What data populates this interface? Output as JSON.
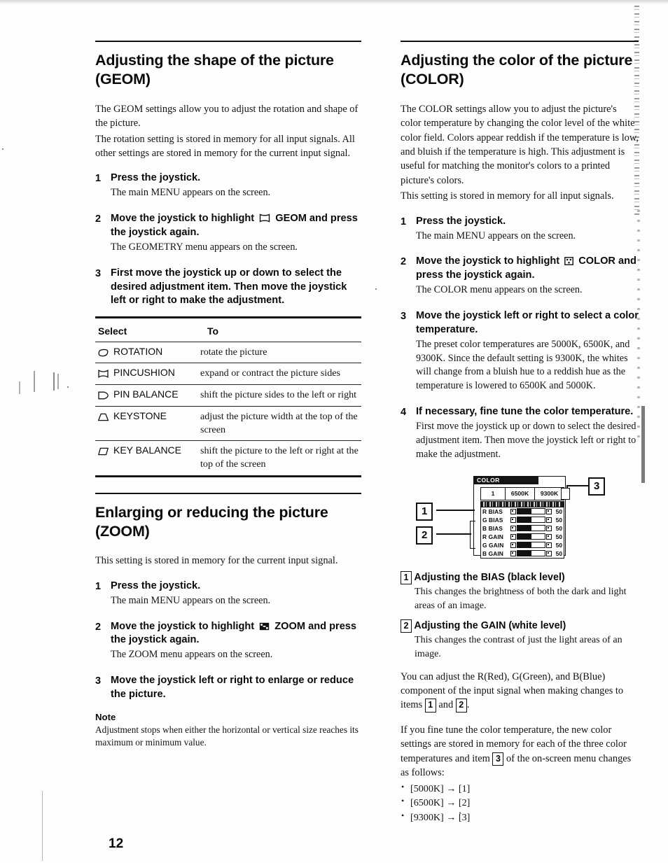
{
  "page": {
    "number": "12"
  },
  "left_column": {
    "heading": "Adjusting the shape of the picture (GEOM)",
    "intro_1": "The GEOM settings allow you to adjust the rotation and shape of the picture.",
    "intro_2": "The rotation setting is stored in memory for all input signals. All other settings are stored in memory for the current input signal.",
    "steps": [
      {
        "num": "1",
        "title": "Press the joystick.",
        "desc": "The main MENU appears on the screen."
      },
      {
        "num": "2",
        "title_before": "Move the joystick to highlight",
        "icon": "geom-pincushion-icon",
        "title_after": "GEOM and press the joystick again.",
        "desc": "The GEOMETRY menu appears on the screen."
      },
      {
        "num": "3",
        "title": "First move the joystick up or down to select the desired adjustment item. Then move the joystick left or right to make the adjustment.",
        "desc": ""
      }
    ],
    "table": {
      "header_select": "Select",
      "header_to": "To",
      "rows": [
        {
          "icon": "rotation-icon",
          "select": "ROTATION",
          "to": "rotate the picture"
        },
        {
          "icon": "pincushion-icon",
          "select": "PINCUSHION",
          "to": "expand or contract the picture sides"
        },
        {
          "icon": "pin-balance-icon",
          "select": "PIN BALANCE",
          "to": "shift the picture sides to the left or right"
        },
        {
          "icon": "keystone-icon",
          "select": "KEYSTONE",
          "to": "adjust the picture width at the top of the screen"
        },
        {
          "icon": "key-balance-icon",
          "select": "KEY BALANCE",
          "to": "shift the picture to the left or right at the top of the screen"
        }
      ]
    },
    "zoom_heading": "Enlarging or reducing the picture (ZOOM)",
    "zoom_intro": "This setting is stored in memory for the current input signal.",
    "zoom_steps": [
      {
        "num": "1",
        "title": "Press the joystick.",
        "desc": "The main MENU appears on the screen."
      },
      {
        "num": "2",
        "title_before": "Move the joystick to highlight",
        "icon": "zoom-icon",
        "title_after": "ZOOM and press the joystick again.",
        "desc": "The ZOOM menu appears on the screen."
      },
      {
        "num": "3",
        "title": "Move the joystick left or right to enlarge or reduce the picture.",
        "desc": ""
      }
    ],
    "note_label": "Note",
    "note_text": "Adjustment stops when either the horizontal or vertical size reaches its maximum or minimum value."
  },
  "right_column": {
    "heading": "Adjusting the color of the picture (COLOR)",
    "intro_1": "The COLOR settings allow you to adjust the picture's color temperature by changing the color level of the white color field. Colors appear reddish if the temperature is low, and bluish if the temperature is high. This adjustment is useful for matching the monitor's colors to a printed picture's colors.",
    "intro_2": "This setting is stored in memory for all input signals.",
    "steps": [
      {
        "num": "1",
        "title": "Press the joystick.",
        "desc": "The main MENU appears on the screen."
      },
      {
        "num": "2",
        "title_before": "Move the joystick to highlight",
        "icon": "color-icon",
        "title_after": "COLOR and press the joystick again.",
        "desc": "The COLOR menu appears on the screen."
      },
      {
        "num": "3",
        "title": "Move the joystick left or right to select a color temperature.",
        "desc": "The preset color temperatures are 5000K, 6500K, and 9300K. Since the default setting is 9300K, the whites will change from a bluish hue to a reddish hue as the temperature is lowered to 6500K and 5000K."
      },
      {
        "num": "4",
        "title": "If necessary, fine tune the color temperature.",
        "desc": "First move the joystick up or down to select the desired adjustment item. Then move the joystick left or right to make the adjustment."
      }
    ],
    "osd": {
      "title": "COLOR",
      "tabs": [
        "1",
        "6500K",
        "9300K"
      ],
      "rows": [
        {
          "label": "R BIAS",
          "value": "50",
          "fill": 52
        },
        {
          "label": "G BIAS",
          "value": "50",
          "fill": 52
        },
        {
          "label": "B BIAS",
          "value": "50",
          "fill": 52
        },
        {
          "label": "R GAIN",
          "value": "50",
          "fill": 52
        },
        {
          "label": "G GAIN",
          "value": "50",
          "fill": 52
        },
        {
          "label": "B GAIN",
          "value": "50",
          "fill": 52
        }
      ],
      "callout_1": "1",
      "callout_2": "2",
      "callout_3": "3"
    },
    "definitions": [
      {
        "tag": "1",
        "head": "Adjusting the BIAS (black level)",
        "body": "This changes the brightness of both the dark and light areas of an image."
      },
      {
        "tag": "2",
        "head": "Adjusting the GAIN (white level)",
        "body": "This changes the contrast of just the light areas of an image."
      }
    ],
    "rgb_note_before": "You can adjust the R(Red), G(Green), and B(Blue) component of the input signal when making changes to items",
    "rgb_tag_1": "1",
    "rgb_and": "and",
    "rgb_tag_2": "2",
    "rgb_note_after": ".",
    "final_note_before": "If you fine tune the color temperature, the new color settings are stored in memory for each of the three color temperatures and item",
    "final_tag": "3",
    "final_note_after": "of the on-screen menu changes as follows:",
    "mappings": [
      "[5000K] → [1]",
      "[6500K] → [2]",
      "[9300K] → [3]"
    ]
  }
}
